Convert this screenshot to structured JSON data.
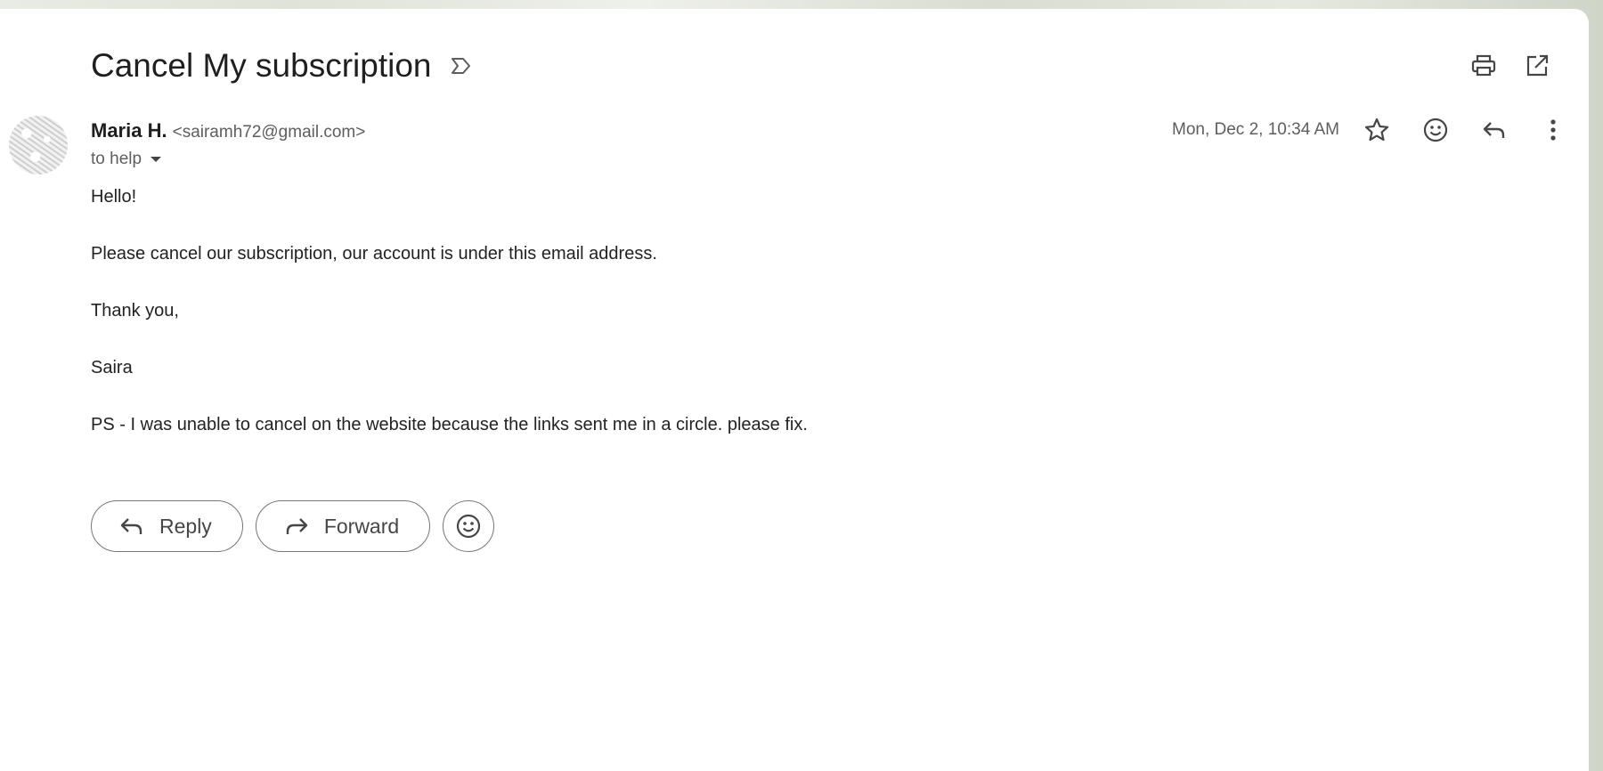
{
  "email": {
    "subject": "Cancel My subscription",
    "sender_name": "Maria H.",
    "sender_email": "<sairamh72@gmail.com>",
    "recipient_line": "to help",
    "date": "Mon, Dec 2, 10:34 AM",
    "body_lines": [
      "Hello!",
      "Please cancel our subscription, our account is under this email address.",
      "Thank you,",
      "Saira",
      "PS - I was unable to cancel on the website because the links sent me in a circle. please fix."
    ]
  },
  "actions": {
    "reply_label": "Reply",
    "forward_label": "Forward"
  },
  "icons": {
    "label": "label-important-icon",
    "print": "print-icon",
    "open_new_window": "open-in-new-icon",
    "star": "star-icon",
    "emoji": "emoji-icon",
    "reply": "reply-icon",
    "more": "more-vert-icon",
    "forward": "forward-icon"
  },
  "colors": {
    "icon": "#444746",
    "secondary_text": "#5e5e5e",
    "button_border": "#747775"
  }
}
